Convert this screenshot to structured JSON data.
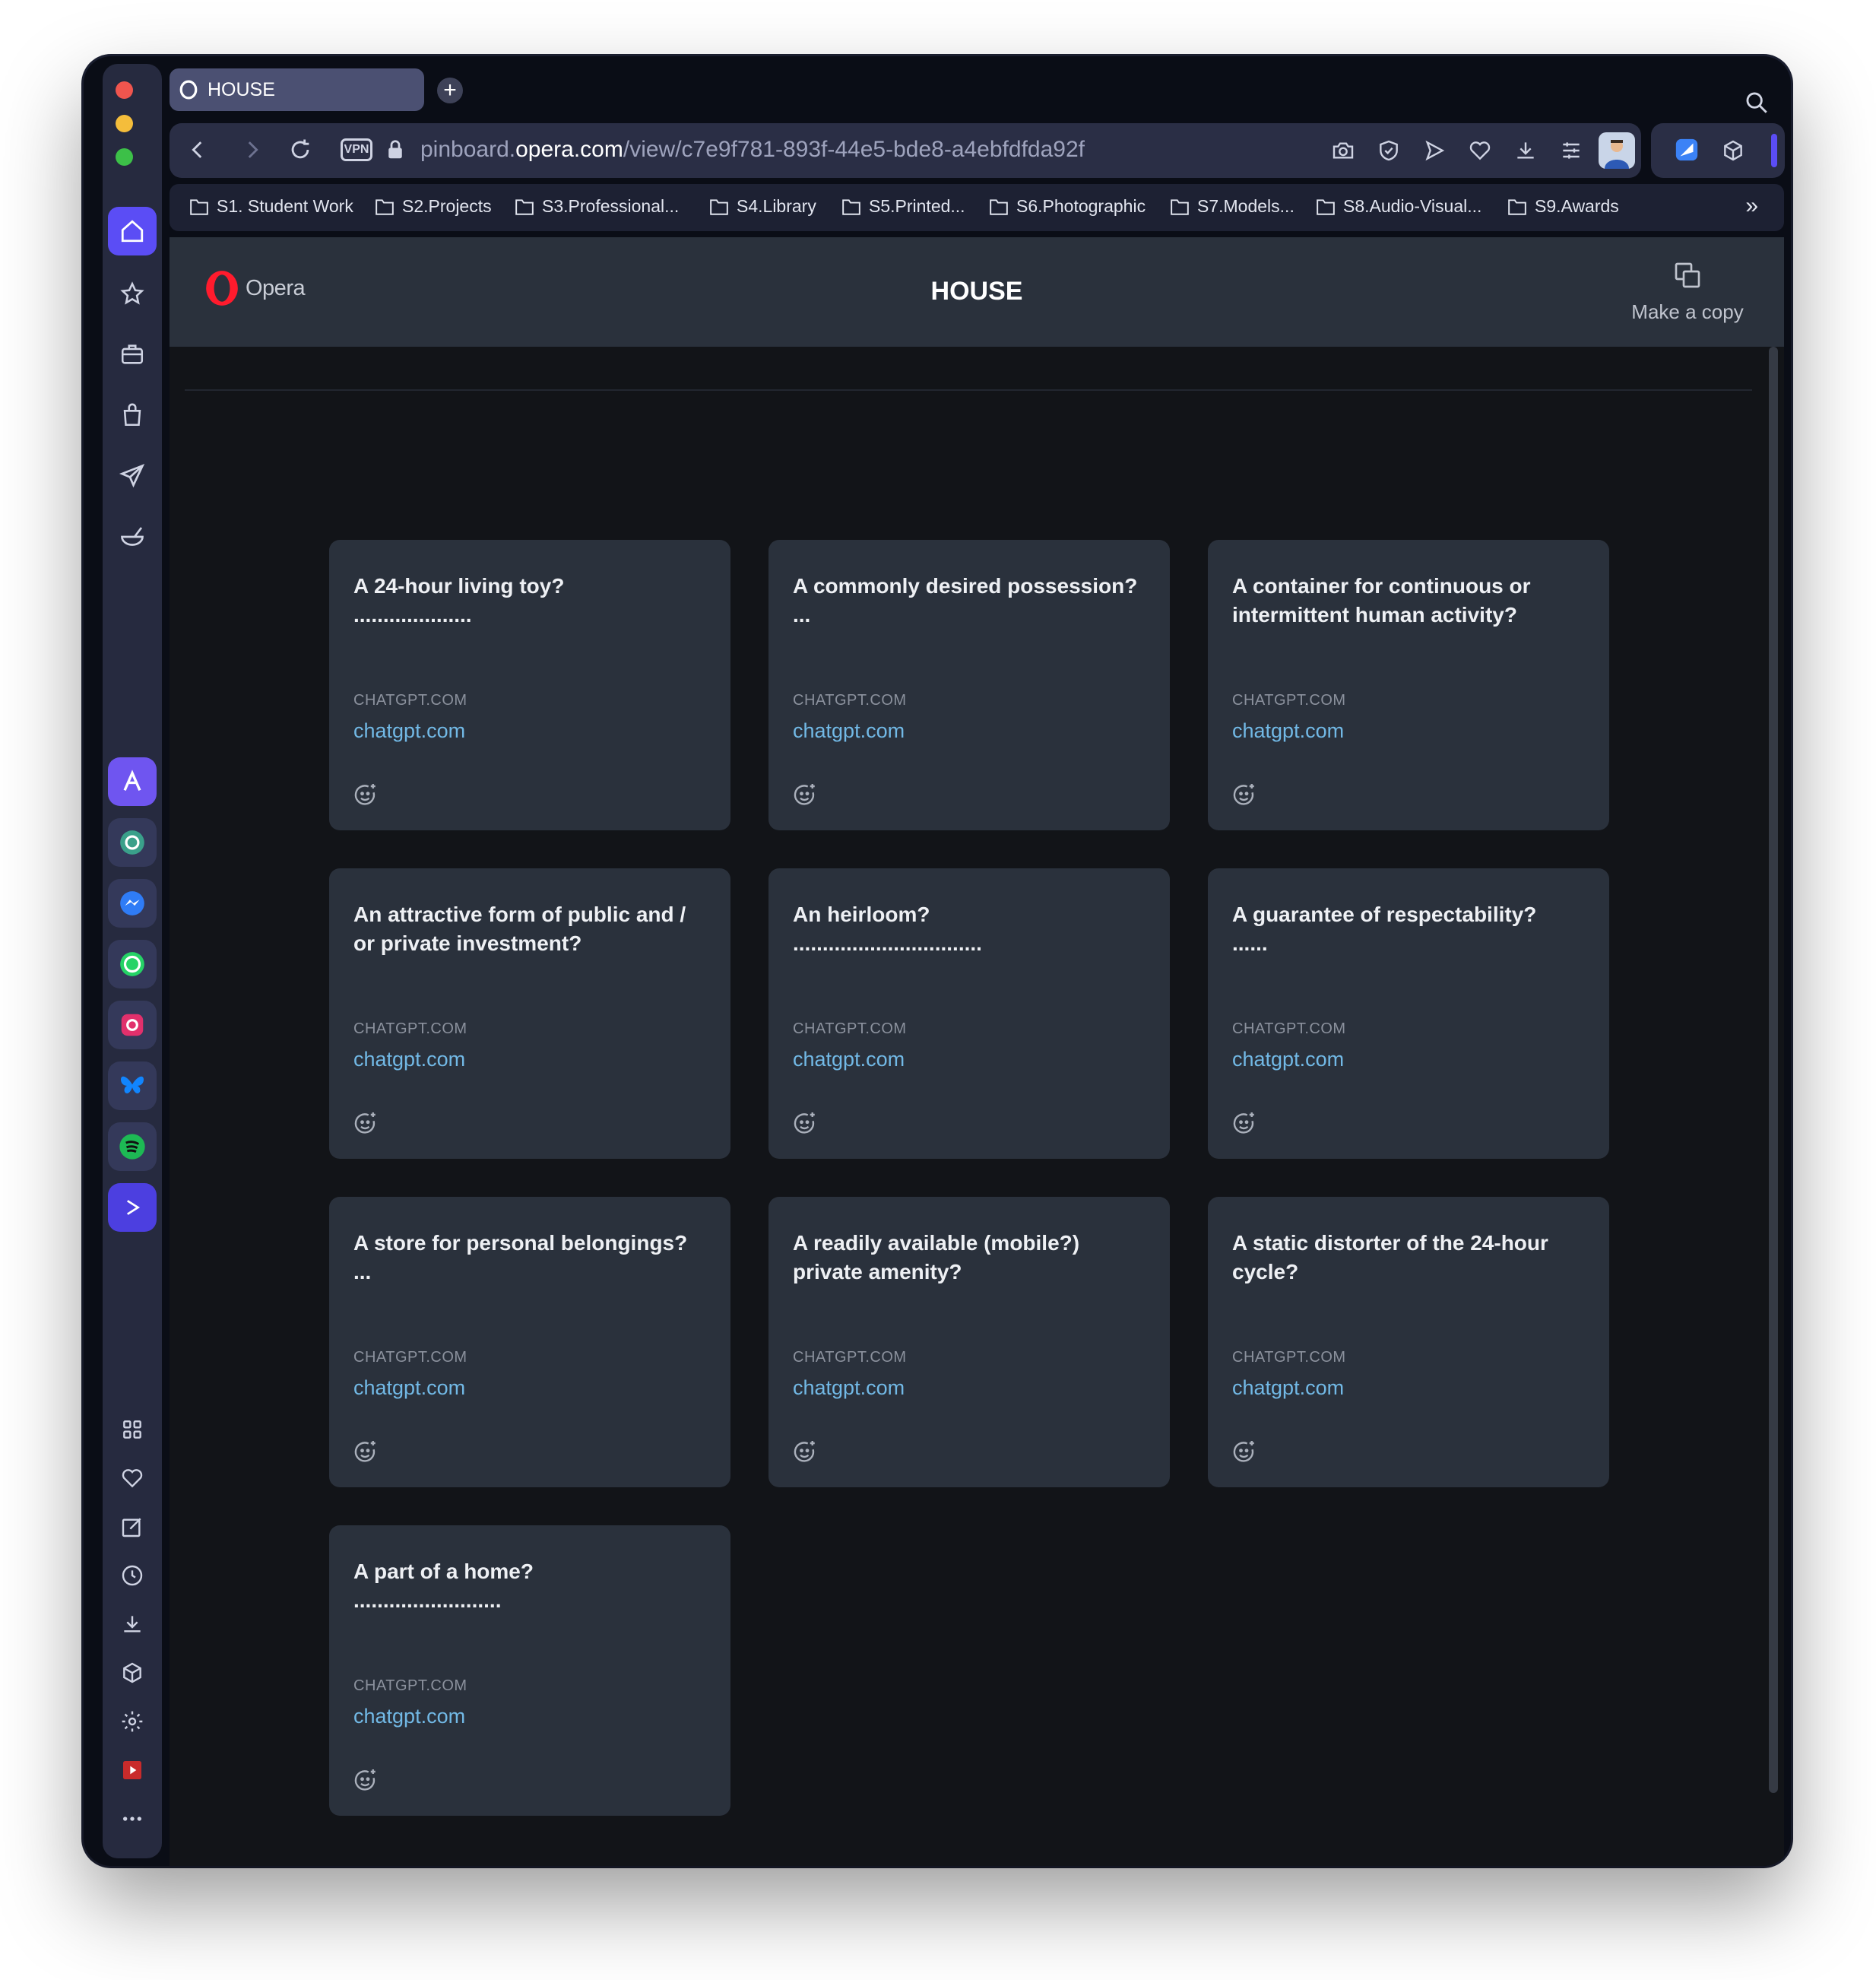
{
  "window": {
    "traffic_lights": {
      "close": "#f0554e",
      "minimize": "#f4bd3b",
      "maximize": "#3cc048"
    }
  },
  "tab": {
    "title": "HOUSE",
    "new_tab_label": "+"
  },
  "address_bar": {
    "vpn_label": "VPN",
    "url_prefix": "pinboard.",
    "url_domain": "opera.com",
    "url_path": "/view/c7e9f781-893f-44e5-bde8-a4ebfdfda92f"
  },
  "bookmarks": [
    {
      "label": "S1. Student Work"
    },
    {
      "label": "S2.Projects"
    },
    {
      "label": "S3.Professional..."
    },
    {
      "label": "S4.Library"
    },
    {
      "label": "S5.Printed..."
    },
    {
      "label": "S6.Photographic"
    },
    {
      "label": "S7.Models..."
    },
    {
      "label": "S8.Audio-Visual..."
    },
    {
      "label": "S9.Awards"
    }
  ],
  "bookmarks_more": "»",
  "header": {
    "logo_text": "Opera",
    "title": "HOUSE",
    "copy_label": "Make a copy"
  },
  "cards": [
    {
      "title": "A 24-hour living toy?\n....................",
      "source": "CHATGPT.COM",
      "link": "chatgpt.com"
    },
    {
      "title": "A commonly desired possession?\n...",
      "source": "CHATGPT.COM",
      "link": "chatgpt.com"
    },
    {
      "title": "A container for continuous or\nintermittent human activity?",
      "source": "CHATGPT.COM",
      "link": "chatgpt.com"
    },
    {
      "title": "An attractive form of public and /\nor private investment?",
      "source": "CHATGPT.COM",
      "link": "chatgpt.com"
    },
    {
      "title": "An heirloom?\n................................",
      "source": "CHATGPT.COM",
      "link": "chatgpt.com"
    },
    {
      "title": "A guarantee of respectability?\n......",
      "source": "CHATGPT.COM",
      "link": "chatgpt.com"
    },
    {
      "title": "A store for personal belongings?\n...",
      "source": "CHATGPT.COM",
      "link": "chatgpt.com"
    },
    {
      "title": "A readily available (mobile?)\nprivate amenity?",
      "source": "CHATGPT.COM",
      "link": "chatgpt.com"
    },
    {
      "title": "A static distorter of the 24-hour\ncycle?",
      "source": "CHATGPT.COM",
      "link": "chatgpt.com"
    },
    {
      "title": "A part of a home?\n.........................",
      "source": "CHATGPT.COM",
      "link": "chatgpt.com"
    }
  ],
  "sidebar_apps": [
    {
      "name": "aria-app",
      "color": "#7a5cf5"
    },
    {
      "name": "chatgpt-app",
      "color": "#3aa08a"
    },
    {
      "name": "messenger-app",
      "color": "#2f7cf6"
    },
    {
      "name": "whatsapp-app",
      "color": "#25d366"
    },
    {
      "name": "instagram-app",
      "color": "#e1306c"
    },
    {
      "name": "bluesky-app",
      "color": "#1185fe"
    },
    {
      "name": "spotify-app",
      "color": "#1db954"
    },
    {
      "name": "player-app",
      "color": "#5b4df5"
    }
  ]
}
